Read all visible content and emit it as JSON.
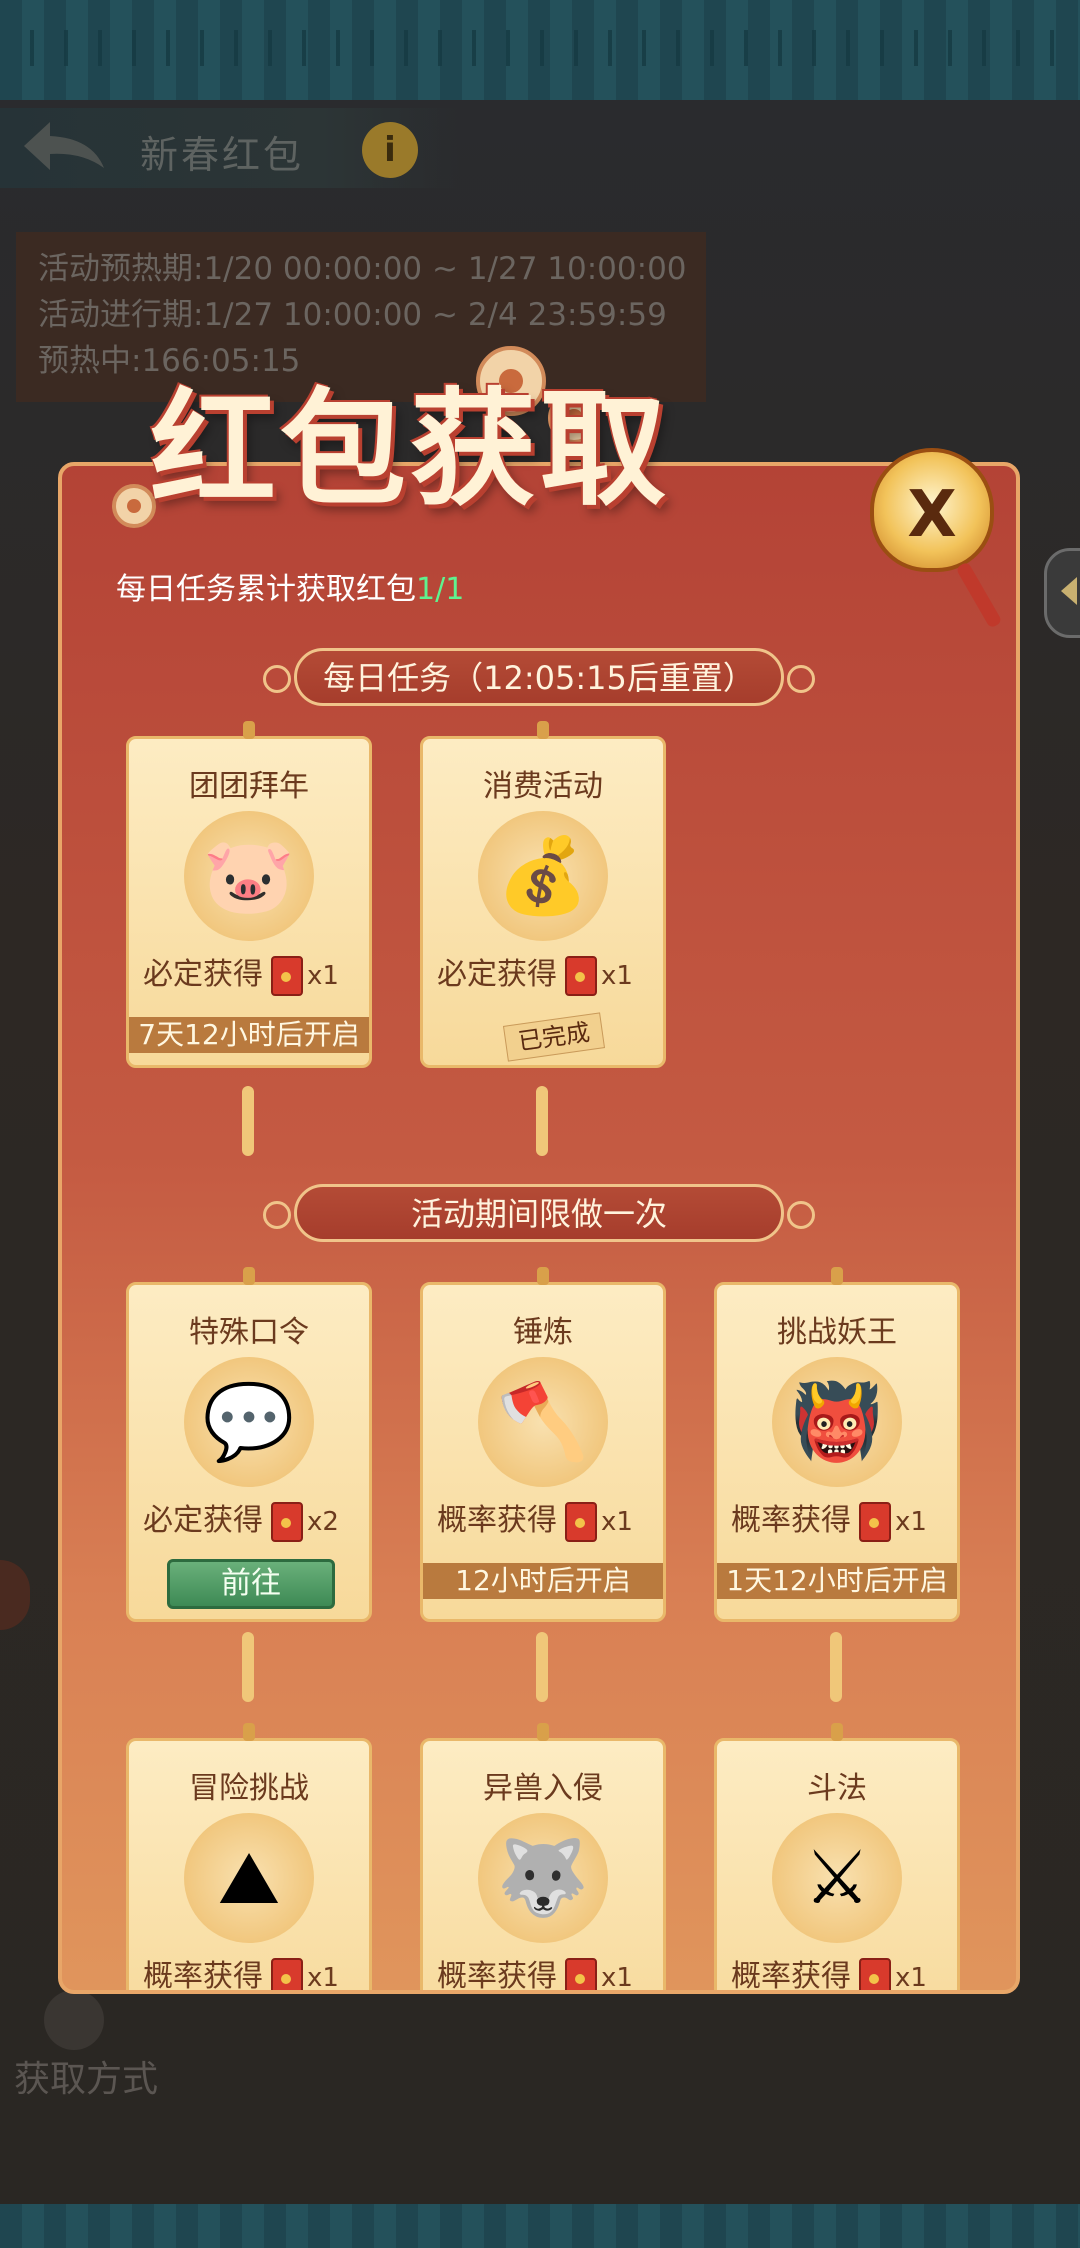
{
  "header": {
    "title": "新春红包",
    "info_icon": "i"
  },
  "event_times": [
    "活动预热期:1/20 00:00:00 ~ 1/27 10:00:00",
    "活动进行期:1/27 10:00:00 ~ 2/4 23:59:59",
    "预热中:166:05:15"
  ],
  "panel": {
    "title": "红包获取",
    "progress_label": "每日任务累计获取红包",
    "progress_value": "1/1",
    "close_icon": "X"
  },
  "daily": {
    "banner": "每日任务（12:05:15后重置）",
    "cards": [
      {
        "title": "团团拜年",
        "icon": "🐷",
        "reward_label": "必定获得",
        "mult": "x1",
        "status": "7天12小时后开启"
      },
      {
        "title": "消费活动",
        "icon": "💰",
        "reward_label": "必定获得",
        "mult": "x1",
        "done": "已完成"
      }
    ]
  },
  "once": {
    "banner": "活动期间限做一次",
    "cards": [
      {
        "title": "特殊口令",
        "icon": "💬",
        "reward_label": "必定获得",
        "mult": "x2",
        "button": "前往"
      },
      {
        "title": "锤炼",
        "icon": "🪓",
        "reward_label": "概率获得",
        "mult": "x1",
        "status": "12小时后开启"
      },
      {
        "title": "挑战妖王",
        "icon": "👹",
        "reward_label": "概率获得",
        "mult": "x1",
        "status": "1天12小时后开启"
      },
      {
        "title": "冒险挑战",
        "icon": "⛰",
        "reward_label": "概率获得",
        "mult": "x1"
      },
      {
        "title": "异兽入侵",
        "icon": "🐺",
        "reward_label": "概率获得",
        "mult": "x1"
      },
      {
        "title": "斗法",
        "icon": "⚔",
        "reward_label": "概率获得",
        "mult": "x1"
      }
    ]
  },
  "footer": {
    "get_method": "获取方式"
  },
  "colors": {
    "panel_red": "#b44336",
    "card_cream": "#fdecc3",
    "go_green": "#3e8a55",
    "progress_green": "#5ff28f"
  }
}
